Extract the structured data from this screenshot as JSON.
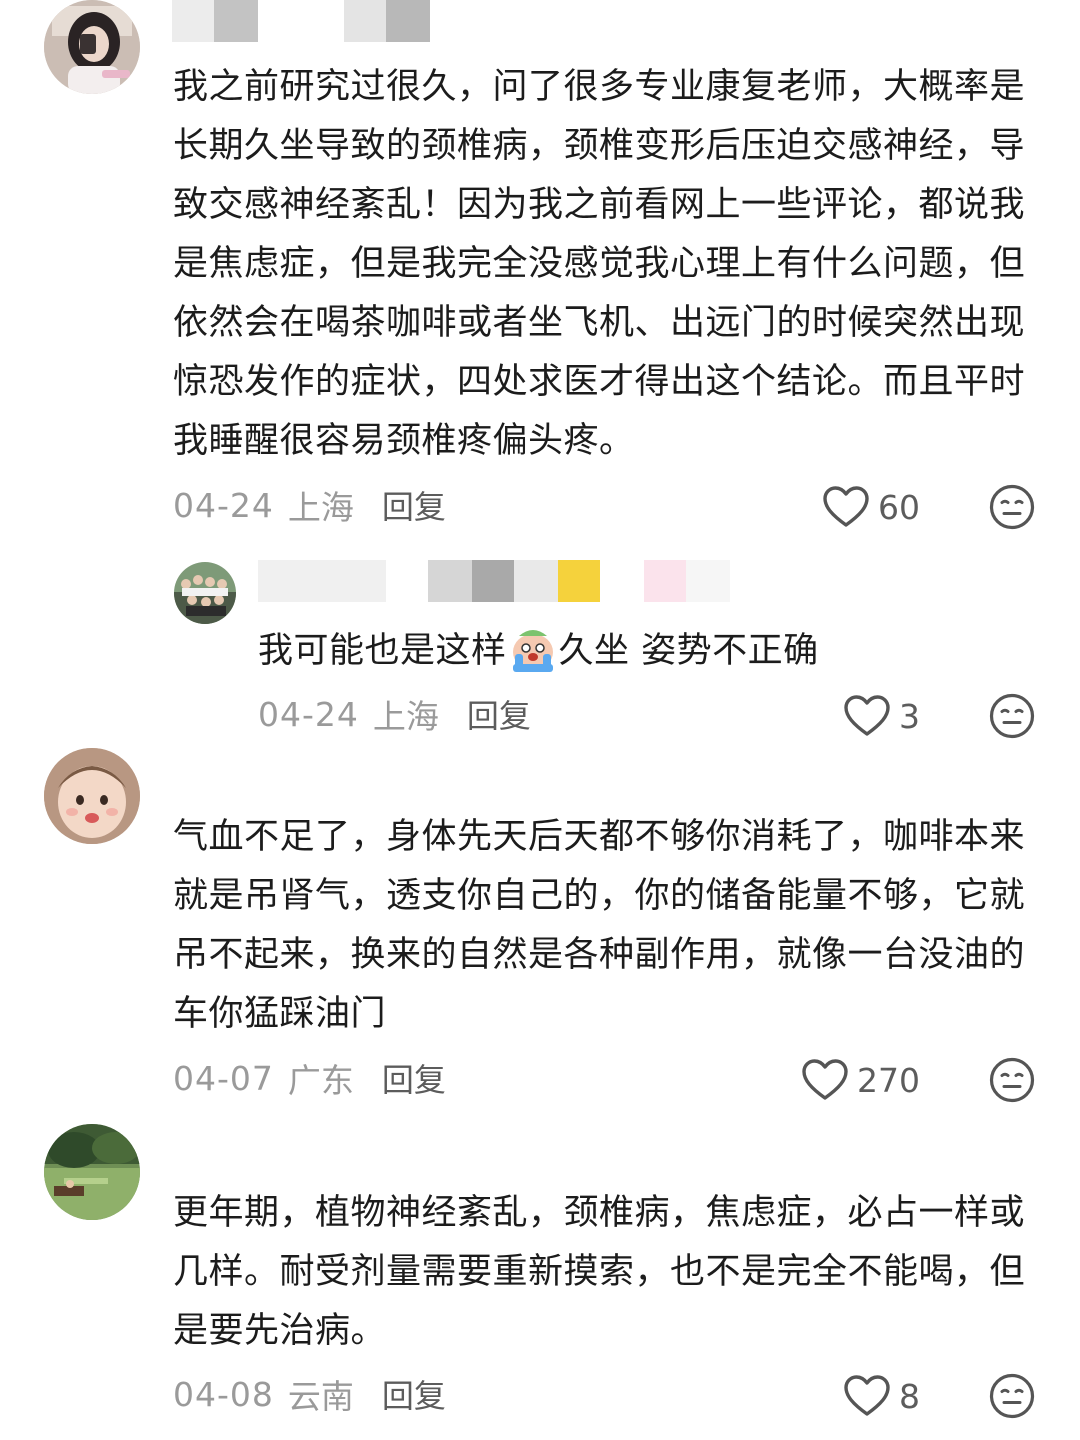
{
  "comments": [
    {
      "text": "我之前研究过很久，问了很多专业康复老师，大概率是长期久坐导致的颈椎病，颈椎变形后压迫交感神经，导致交感神经紊乱！因为我之前看网上一些评论，都说我是焦虑症，但是我完全没感觉我心理上有什么问题，但依然会在喝茶咖啡或者坐飞机、出远门的时候突然出现惊恐发作的症状，四处求医才得出这个结论。而且平时我睡醒很容易颈椎疼偏头疼。",
      "date": "04-24",
      "location": "上海",
      "reply_label": "回复",
      "likes": "60",
      "replies": [
        {
          "text_before": "我可能也是这样",
          "text_after": "久坐 姿势不正确",
          "emoji": "crying-emoji",
          "date": "04-24",
          "location": "上海",
          "reply_label": "回复",
          "likes": "3"
        }
      ]
    },
    {
      "text": "气血不足了，身体先天后天都不够你消耗了，咖啡本来就是吊肾气，透支你自己的，你的储备能量不够，它就吊不起来，换来的自然是各种副作用，就像一台没油的车你猛踩油门",
      "date": "04-07",
      "location": "广东",
      "reply_label": "回复",
      "likes": "270"
    },
    {
      "text": "更年期，植物神经紊乱，颈椎病，焦虑症，必占一样或几样。耐受剂量需要重新摸索，也不是完全不能喝，但是要先治病。",
      "date": "04-08",
      "location": "云南",
      "reply_label": "回复",
      "likes": "8"
    }
  ],
  "icons": {
    "like": "heart-outline-icon",
    "dislike": "meh-face-icon"
  },
  "colors": {
    "text": "#1c1c1c",
    "meta": "#9a9a9a",
    "icon": "#555555"
  }
}
